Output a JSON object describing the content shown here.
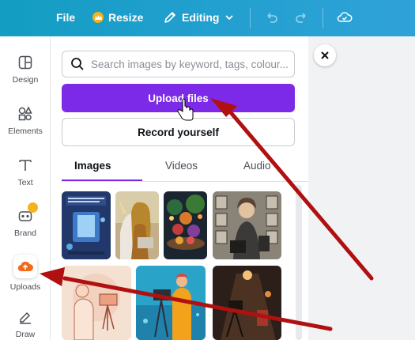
{
  "topbar": {
    "file_label": "File",
    "resize_label": "Resize",
    "editing_label": "Editing",
    "accent_color": "#7d2ae8",
    "bar_color": "#1f9fcd"
  },
  "sidebar": {
    "items": [
      {
        "label": "Design",
        "icon": "design-icon"
      },
      {
        "label": "Elements",
        "icon": "elements-icon"
      },
      {
        "label": "Text",
        "icon": "text-icon"
      },
      {
        "label": "Brand",
        "icon": "brand-icon"
      },
      {
        "label": "Uploads",
        "icon": "upload-cloud-icon"
      },
      {
        "label": "Draw",
        "icon": "draw-icon"
      }
    ]
  },
  "panel": {
    "search_placeholder": "Search images by keyword, tags, colour...",
    "upload_label": "Upload files",
    "record_label": "Record yourself",
    "tabs": [
      {
        "label": "Images"
      },
      {
        "label": "Videos"
      },
      {
        "label": "Audio"
      }
    ],
    "active_tab": "Images"
  },
  "annotations": {
    "arrow_color": "#b01010"
  }
}
